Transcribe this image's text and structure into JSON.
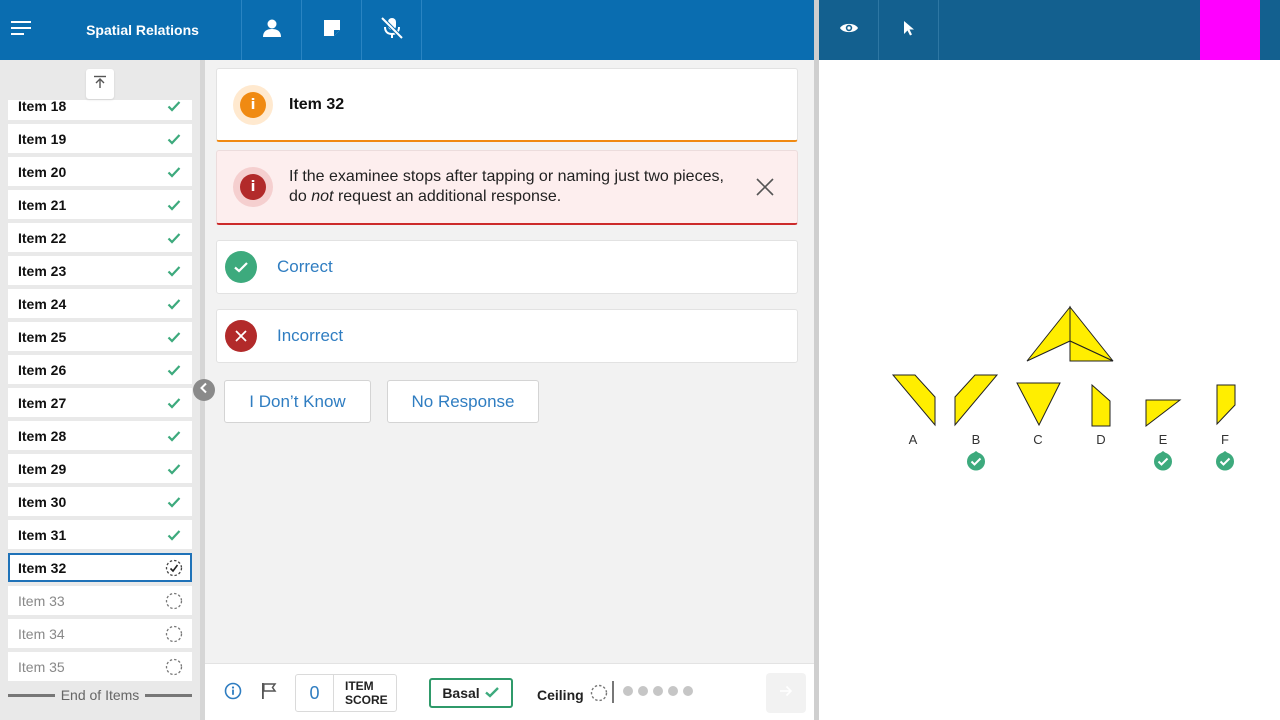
{
  "header": {
    "title": "Spatial Relations"
  },
  "icons": {
    "menu": "menu-icon",
    "person": "person-icon",
    "note": "note-icon",
    "mic_off": "mic-off-icon",
    "eye": "eye-icon",
    "pointer": "pointer-icon",
    "scroll_top": "arrow-up-to-top-icon",
    "collapse": "chevron-left-icon",
    "close": "close-icon"
  },
  "sidebar": {
    "items": [
      {
        "label": "Item 18",
        "status": "done"
      },
      {
        "label": "Item 19",
        "status": "done"
      },
      {
        "label": "Item 20",
        "status": "done"
      },
      {
        "label": "Item 21",
        "status": "done"
      },
      {
        "label": "Item 22",
        "status": "done"
      },
      {
        "label": "Item 23",
        "status": "done"
      },
      {
        "label": "Item 24",
        "status": "done"
      },
      {
        "label": "Item 25",
        "status": "done"
      },
      {
        "label": "Item 26",
        "status": "done"
      },
      {
        "label": "Item 27",
        "status": "done"
      },
      {
        "label": "Item 28",
        "status": "done"
      },
      {
        "label": "Item 29",
        "status": "done"
      },
      {
        "label": "Item 30",
        "status": "done"
      },
      {
        "label": "Item 31",
        "status": "done"
      },
      {
        "label": "Item 32",
        "status": "current"
      },
      {
        "label": "Item 33",
        "status": "pending"
      },
      {
        "label": "Item 34",
        "status": "pending"
      },
      {
        "label": "Item 35",
        "status": "pending"
      }
    ],
    "end_label": "End of Items"
  },
  "item": {
    "title": "Item 32",
    "alert_before": "If the examinee stops after tapping or naming just two pieces, do ",
    "alert_emph": "not",
    "alert_after": " request an additional response."
  },
  "responses": {
    "correct_label": "Correct",
    "incorrect_label": "Incorrect",
    "dont_know_label": "I Don’t Know",
    "no_response_label": "No Response"
  },
  "footer": {
    "item_score": "0",
    "item_score_label_1": "ITEM",
    "item_score_label_2": "SCORE",
    "basal_label": "Basal",
    "ceiling_label": "Ceiling",
    "dot_count": 5
  },
  "stimulus": {
    "choices": [
      {
        "label": "A",
        "selected": false
      },
      {
        "label": "B",
        "selected": true
      },
      {
        "label": "C",
        "selected": false
      },
      {
        "label": "D",
        "selected": false
      },
      {
        "label": "E",
        "selected": true
      },
      {
        "label": "F",
        "selected": true
      }
    ]
  },
  "colors": {
    "topbar": "#0a6db0",
    "topbar_right": "#13608f",
    "accent_magenta": "#ff00ff",
    "check_green": "#3daa7d",
    "incorrect_red": "#b22a2a",
    "info_orange": "#f08a12",
    "alert_red": "#cc2a2a",
    "link_blue": "#2f7dc1",
    "piece_yellow": "#ffee00"
  }
}
